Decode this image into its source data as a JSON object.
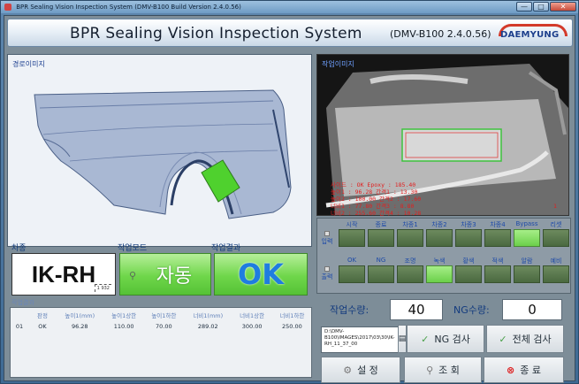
{
  "window": {
    "title": "BPR Sealing Vision Inspection System (DMV-B100 Build Version 2.4.0.56)",
    "buttons": [
      "—",
      "□",
      "✕"
    ]
  },
  "header": {
    "title": "BPR Sealing Vision Inspection System",
    "version": "(DMV-B100 2.4.0.56)",
    "logo_text": "DAEMYUNG"
  },
  "route_image": {
    "label": "경로이미지"
  },
  "work_image": {
    "label": "작업이미지",
    "overlay_lines": [
      "사이드 : OK    Epoxy : 185.40",
      "높이1 : 96.28  간격1 : 13.30",
      "높이2 : 100.00 간격2 : 17.60",
      "너비1 : 77.80  간격3 : 8.80",
      "너비2 : 255.60 간격4 : 10.28"
    ],
    "corner_mark": "1"
  },
  "vehicle": {
    "label": "차종",
    "value": "IK-RH",
    "thumb_text": "1  932"
  },
  "mode": {
    "label": "작업모드",
    "value": "자동"
  },
  "result": {
    "label": "작업결과",
    "value": "OK"
  },
  "results_table": {
    "label": "작업결과",
    "headers": [
      "",
      "판정",
      "높이1(mm)",
      "높이1상한",
      "높이1하한",
      "너비1(mm)",
      "너비1상한",
      "너비1하한"
    ],
    "rows": [
      [
        "01",
        "OK",
        "96.28",
        "110.00",
        "70.00",
        "289.02",
        "300.00",
        "250.00"
      ]
    ]
  },
  "io": {
    "input_label": "입력",
    "output_label": "출력",
    "inputs": [
      "시작",
      "종료",
      "차종1",
      "차종2",
      "차종3",
      "차종4",
      "Bypass",
      "리셋"
    ],
    "outputs": [
      "OK",
      "NG",
      "조명",
      "녹색",
      "황색",
      "적색",
      "알람",
      "예비"
    ],
    "input_states": [
      false,
      false,
      false,
      false,
      false,
      false,
      true,
      false
    ],
    "output_states": [
      false,
      false,
      false,
      true,
      false,
      false,
      false,
      false
    ]
  },
  "counts": {
    "work_label": "작업수량:",
    "work_value": "40",
    "ng_label": "NG수량:",
    "ng_value": "0"
  },
  "path": {
    "text": "D:\\DMV-B100\\IMAGES\\2017\\03\\30\\IK-RH_11_37_00"
  },
  "buttons": {
    "ng_check": "NG 검사",
    "full_check": "전체 검사",
    "settings": "설 정",
    "search": "조 회",
    "exit": "종 료"
  },
  "colors": {
    "accent_green": "#6fd64a",
    "header_blue": "#4a73a0",
    "label_blue": "#1d4aa8"
  }
}
